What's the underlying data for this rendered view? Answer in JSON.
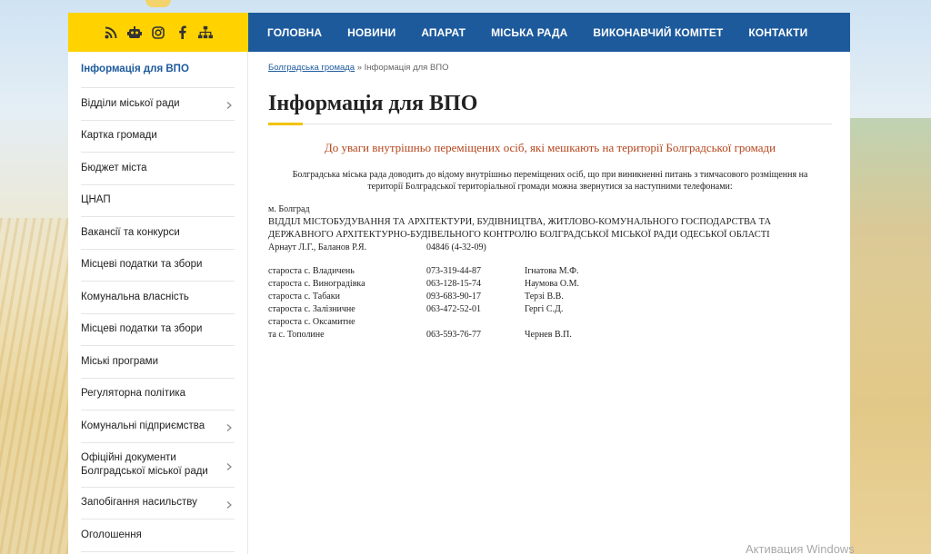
{
  "social": {
    "icons": [
      "rss-icon",
      "robot-icon",
      "instagram-icon",
      "facebook-icon",
      "sitemap-icon"
    ]
  },
  "nav": [
    "ГОЛОВНА",
    "НОВИНИ",
    "АПАРАТ",
    "МІСЬКА РАДА",
    "ВИКОНАВЧИЙ КОМІТЕТ",
    "КОНТАКТИ"
  ],
  "sidebar": [
    {
      "label": "Інформація для ВПО",
      "chevron": false
    },
    {
      "label": "Відділи міської ради",
      "chevron": true
    },
    {
      "label": "Картка громади",
      "chevron": false
    },
    {
      "label": "Бюджет міста",
      "chevron": false
    },
    {
      "label": "ЦНАП",
      "chevron": false
    },
    {
      "label": "Вакансії та конкурси",
      "chevron": false
    },
    {
      "label": "Місцеві податки та збори",
      "chevron": false
    },
    {
      "label": "Комунальна власність",
      "chevron": false
    },
    {
      "label": "Місцеві податки та збори",
      "chevron": false
    },
    {
      "label": "Міські програми",
      "chevron": false
    },
    {
      "label": "Регуляторна політика",
      "chevron": false
    },
    {
      "label": "Комунальні підприємства",
      "chevron": true
    },
    {
      "label": "Офіційні документи Болградської міської ради",
      "chevron": true
    },
    {
      "label": "Запобігання насильству",
      "chevron": true
    },
    {
      "label": "Оголошення",
      "chevron": false
    }
  ],
  "breadcrumb": {
    "home": "Болградська громада",
    "separator": "»",
    "current": "Інформація для ВПО"
  },
  "page": {
    "title": "Інформація для ВПО",
    "notice": "До уваги внутрішньо переміщених осіб, які мешкають на території Болградської громади",
    "intro": "Болградська міська рада доводить до відому внутрішньо переміщених осіб, що при виникненні питань  з тимчасового розміщення на території Болградської територіальної громади можна звернутися за наступними телефонами:",
    "city": "м. Болград",
    "department": "ВІДДІЛ МІСТОБУДУВАННЯ ТА АРХІТЕКТУРИ, БУДІВНИЦТВА, ЖИТЛОВО-КОМУНАЛЬНОГО ГОСПОДАРСТВА ТА ДЕРЖАВНОГО АРХІТЕКТУРНО-БУДІВЕЛЬНОГО КОНТРОЛЮ БОЛГРАДСЬКОЇ МІСЬКОЇ РАДИ ОДЕСЬКОЇ ОБЛАСТІ",
    "dept_contact": {
      "name": "Арнаут Л.Г., Баланов Р.Я.",
      "phone": "04846 (4-32-09)"
    },
    "starosty": [
      {
        "place": "староста с. Владичень",
        "phone": "073-319-44-87",
        "name": "Ігнатова М.Ф."
      },
      {
        "place": "староста с. Виноградівка",
        "phone": "063-128-15-74",
        "name": "Наумова О.М."
      },
      {
        "place": "староста с. Табаки",
        "phone": "093-683-90-17",
        "name": "Терзі В.В."
      },
      {
        "place": "староста с. Залізничне",
        "phone": "063-472-52-01",
        "name": "Гергі С.Д."
      },
      {
        "place": "староста с. Оксамитне",
        "phone": "",
        "name": ""
      },
      {
        "place": "та с. Тополине",
        "phone": "063-593-76-77",
        "name": "Чернев В.П."
      }
    ]
  },
  "watermark": "Активация Windows"
}
